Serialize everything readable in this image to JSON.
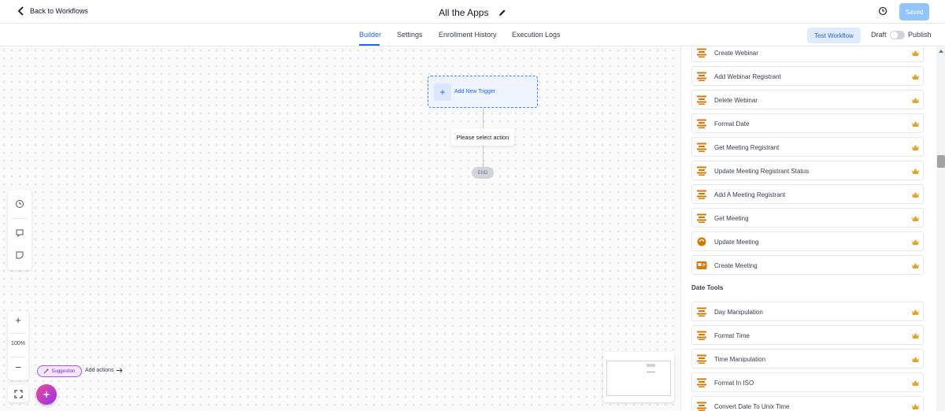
{
  "header": {
    "back_label": "Back to Workflows",
    "title": "All the Apps",
    "saved_label": "Saved"
  },
  "tabs": [
    {
      "label": "Builder",
      "active": true
    },
    {
      "label": "Settings",
      "active": false
    },
    {
      "label": "Enrollment History",
      "active": false
    },
    {
      "label": "Execution Logs",
      "active": false
    }
  ],
  "toolbar": {
    "test_label": "Test Workflow",
    "draft_label": "Draft",
    "publish_label": "Publish",
    "published": false
  },
  "canvas": {
    "trigger_label": "Add New Trigger",
    "action_label": "Please select action",
    "end_label": "END",
    "zoom": "100%",
    "suggestion_label": "Suggestion",
    "add_actions_label": "Add actions"
  },
  "panel": {
    "items_top": [
      {
        "label": "Create Webinar",
        "icon": "app-icon"
      },
      {
        "label": "Add Webinar Registrant",
        "icon": "app-icon"
      },
      {
        "label": "Delete Webinar",
        "icon": "app-icon"
      },
      {
        "label": "Format Date",
        "icon": "app-icon"
      },
      {
        "label": "Get Meeting Registrant",
        "icon": "app-icon"
      },
      {
        "label": "Update Meeting Registrant Status",
        "icon": "app-icon"
      },
      {
        "label": "Add A Meeting Registrant",
        "icon": "app-icon"
      },
      {
        "label": "Get Meeting",
        "icon": "app-icon"
      },
      {
        "label": "Update Meeting",
        "icon": "circle-app-icon"
      },
      {
        "label": "Create Meeting",
        "icon": "card-app-icon"
      }
    ],
    "section_title": "Date Tools",
    "items_date": [
      {
        "label": "Day Manipulation",
        "icon": "app-icon"
      },
      {
        "label": "Format Time",
        "icon": "app-icon"
      },
      {
        "label": "Time Manipulation",
        "icon": "app-icon"
      },
      {
        "label": "Format In ISO",
        "icon": "app-icon"
      },
      {
        "label": "Convert Date To Unix Time",
        "icon": "app-icon"
      }
    ]
  },
  "colors": {
    "accent": "#2563eb",
    "icon_orange": "#d97706",
    "crown_gold": "#e0a526",
    "suggestion_purple": "#7e22ce"
  }
}
